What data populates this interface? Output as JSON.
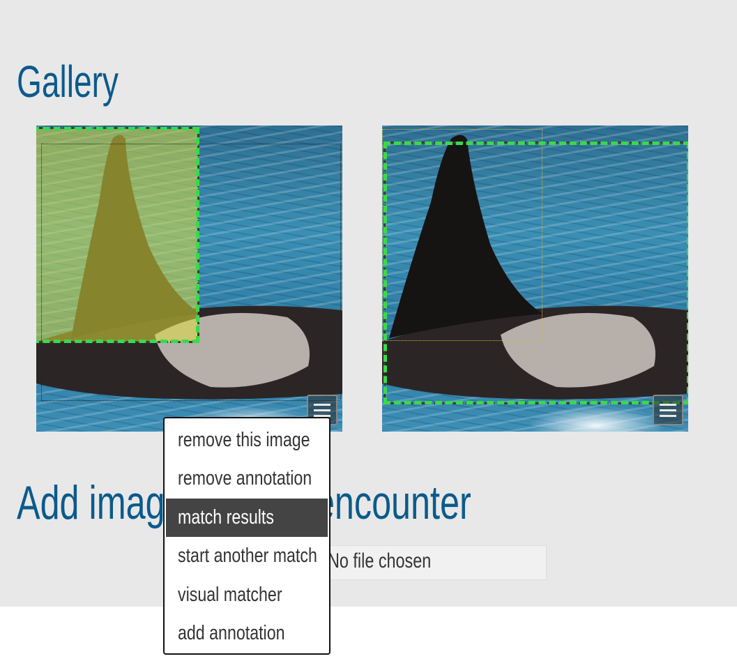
{
  "gallery": {
    "title": "Gallery"
  },
  "add_section": {
    "title": "Add images to this encounter",
    "file_status": "No file chosen"
  },
  "context_menu": {
    "items": [
      {
        "label": "remove this image"
      },
      {
        "label": "remove annotation"
      },
      {
        "label": "match results"
      },
      {
        "label": "start another match"
      },
      {
        "label": "visual matcher"
      },
      {
        "label": "add annotation"
      }
    ],
    "active_index": 2
  },
  "colors": {
    "heading": "#0b5a8c",
    "panel_background": "#e8e8e8",
    "annotation_green": "#3bd94a",
    "menu_active_bg": "#444444"
  },
  "images": [
    {
      "subject": "orca dorsal fin",
      "highlighted_annotation": true,
      "menu_icon": "hamburger-icon"
    },
    {
      "subject": "orca dorsal fin",
      "highlighted_annotation": false,
      "menu_icon": "hamburger-icon"
    }
  ]
}
